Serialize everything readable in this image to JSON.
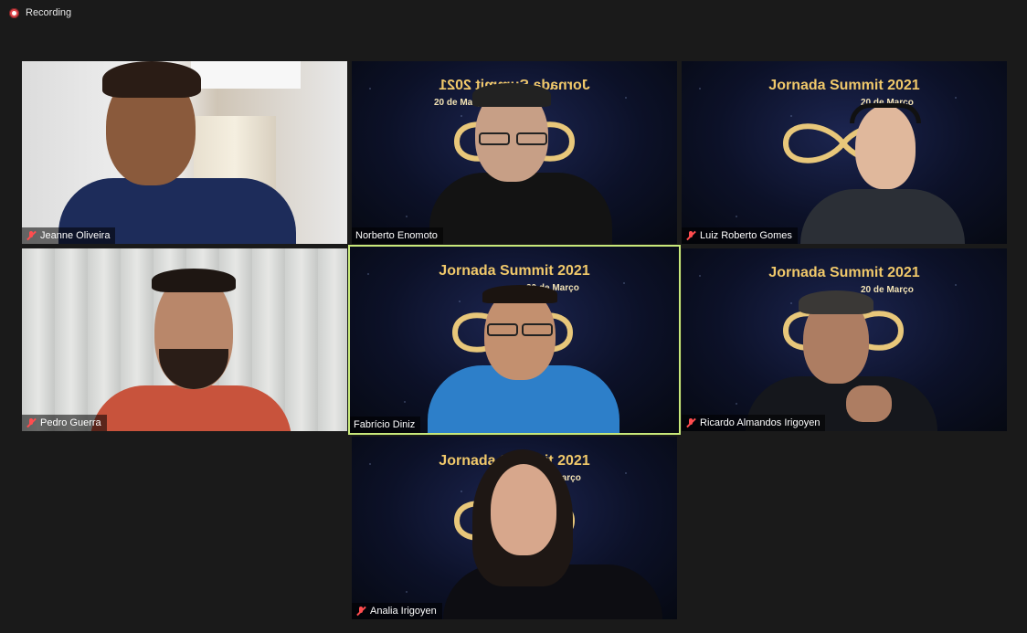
{
  "recording": {
    "label": "Recording"
  },
  "summit": {
    "title": "Jornada Summit 2021",
    "date": "20 de Março"
  },
  "participants": [
    {
      "name": "Jeanne Oliveira",
      "muted": true
    },
    {
      "name": "Norberto Enomoto",
      "muted": false
    },
    {
      "name": "Luiz Roberto Gomes",
      "muted": true
    },
    {
      "name": "Pedro Guerra",
      "muted": true
    },
    {
      "name": "Fabrício Diniz",
      "muted": false,
      "active_speaker": true
    },
    {
      "name": "Ricardo Almandos Irigoyen",
      "muted": true
    },
    {
      "name": "Analia Irigoyen",
      "muted": true
    }
  ],
  "colors": {
    "background": "#1a1a1a",
    "active_border": "#c8e87a",
    "muted_icon": "#ff4d4f",
    "summit_gold": "#f0c86a"
  },
  "icons": {
    "recording": "recording-dot-icon",
    "muted": "mic-off-icon"
  }
}
